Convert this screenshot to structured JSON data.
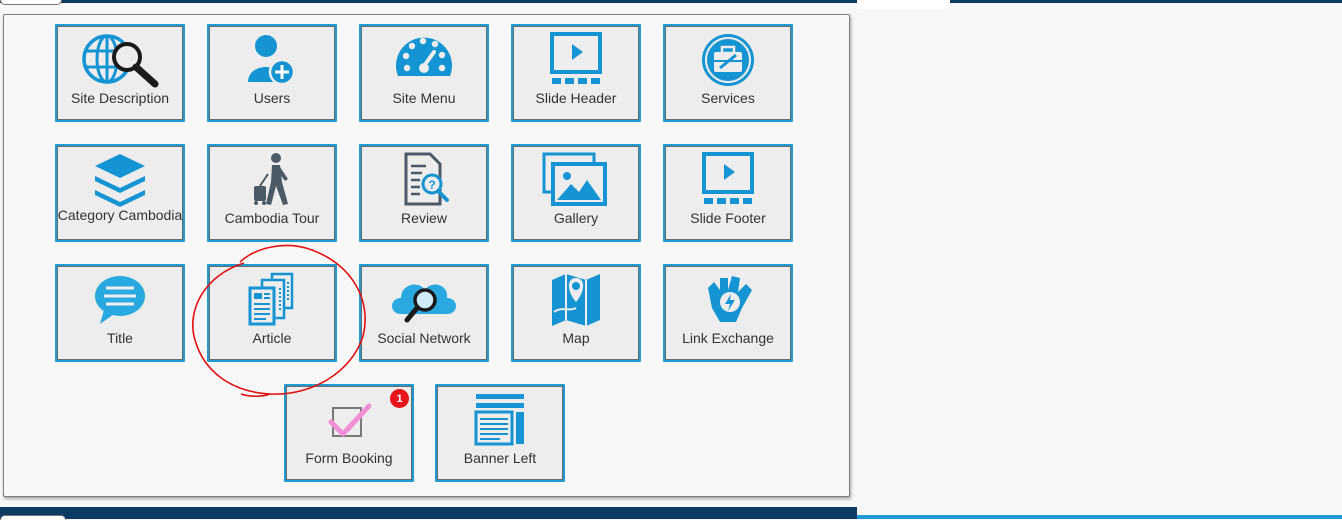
{
  "colors": {
    "accent": "#1a9bd1",
    "icon_blue": "#1594d3",
    "header_navy": "#0c3a63",
    "badge_red": "#e8141a",
    "annotation_red": "#e01010"
  },
  "tiles": [
    {
      "label": "Site Description",
      "icon": "globe-search-icon"
    },
    {
      "label": "Users",
      "icon": "add-user-icon"
    },
    {
      "label": "Site Menu",
      "icon": "speedometer-icon"
    },
    {
      "label": "Slide Header",
      "icon": "video-slide-icon"
    },
    {
      "label": "Services",
      "icon": "toolbox-icon"
    },
    {
      "label": "Category Cambodia",
      "icon": "layers-icon"
    },
    {
      "label": "Cambodia Tour",
      "icon": "traveler-icon"
    },
    {
      "label": "Review",
      "icon": "document-search-icon"
    },
    {
      "label": "Gallery",
      "icon": "gallery-icon"
    },
    {
      "label": "Slide Footer",
      "icon": "video-slide-icon"
    },
    {
      "label": "Title",
      "icon": "chat-bubble-icon"
    },
    {
      "label": "Article",
      "icon": "articles-icon"
    },
    {
      "label": "Social Network",
      "icon": "cloud-search-icon"
    },
    {
      "label": "Map",
      "icon": "map-pin-icon"
    },
    {
      "label": "Link Exchange",
      "icon": "hand-bolt-icon"
    },
    {
      "label": "Form Booking",
      "icon": "checkbox-check-icon",
      "badge": "1"
    },
    {
      "label": "Banner Left",
      "icon": "banner-layout-icon"
    }
  ]
}
